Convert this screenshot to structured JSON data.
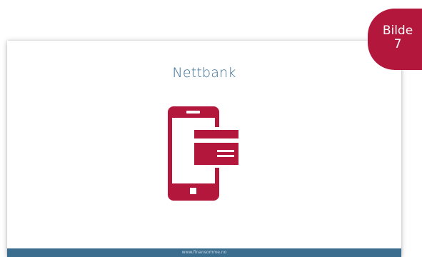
{
  "slide": {
    "title": "Nettbank",
    "footer_text": "www.finansomme.no"
  },
  "badge": {
    "line1": "Bilde",
    "line2": "7"
  },
  "icon": "phone-with-card-icon",
  "colors": {
    "title": "#3a6f96",
    "accent": "#b3173c",
    "footer": "#3b6d8f"
  }
}
